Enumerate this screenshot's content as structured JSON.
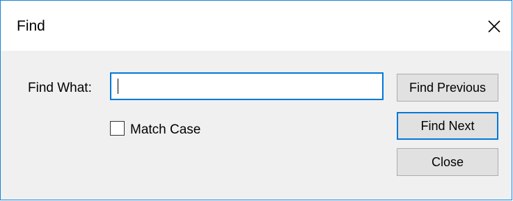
{
  "window": {
    "title": "Find",
    "close_icon": "close-icon"
  },
  "form": {
    "find_what_label": "Find What:",
    "find_what_value": "",
    "match_case_label": "Match Case",
    "match_case_checked": false
  },
  "buttons": {
    "find_previous": "Find Previous",
    "find_next": "Find Next",
    "close": "Close"
  },
  "colors": {
    "accent": "#0078d7",
    "window_border": "#1883d7",
    "dialog_background": "#f0f0f0",
    "button_face": "#e1e1e1"
  }
}
